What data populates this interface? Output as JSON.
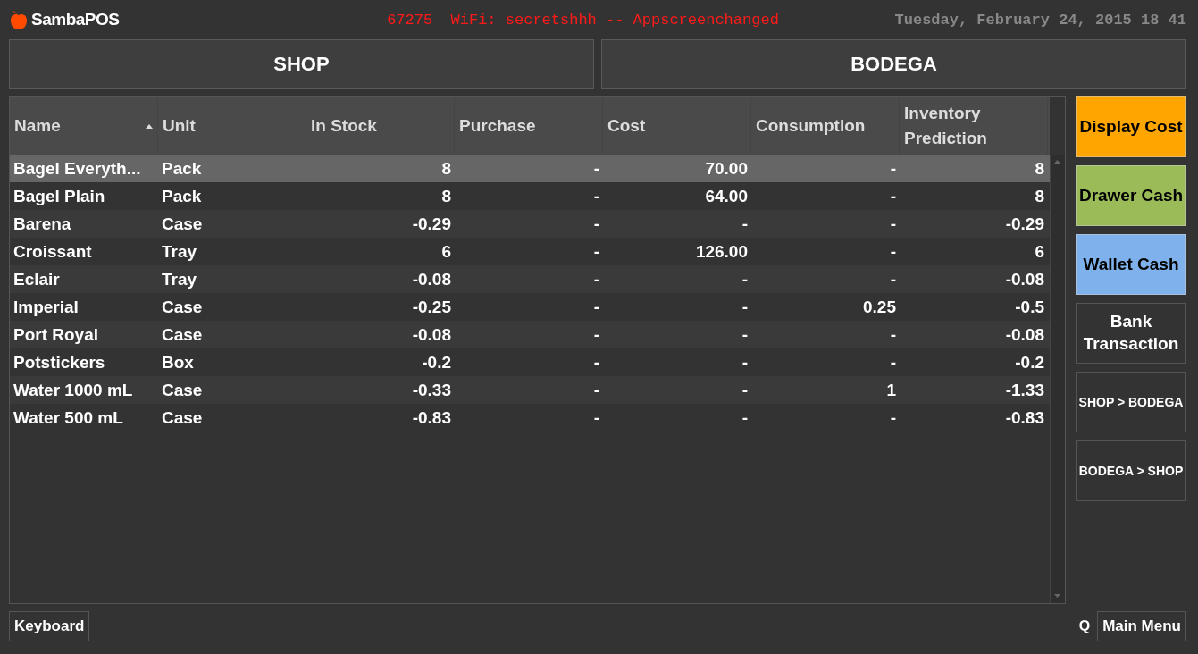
{
  "header": {
    "app_name": "SambaPOS",
    "message": "67275  WiFi: secretshhh -- Appscreenchanged",
    "datetime": "Tuesday, February 24, 2015 18 41"
  },
  "tabs": [
    {
      "label": "SHOP",
      "selected": false
    },
    {
      "label": "BODEGA",
      "selected": false
    }
  ],
  "table": {
    "columns": [
      {
        "label": "Name",
        "kind": "text",
        "sorted": true
      },
      {
        "label": "Unit",
        "kind": "text",
        "sorted": false
      },
      {
        "label": "In Stock",
        "kind": "number",
        "sorted": false
      },
      {
        "label": "Purchase",
        "kind": "number",
        "sorted": false
      },
      {
        "label": "Cost",
        "kind": "number",
        "sorted": false
      },
      {
        "label": "Consumption",
        "kind": "number",
        "sorted": false
      },
      {
        "label": "Inventory Prediction",
        "kind": "number",
        "sorted": false
      }
    ],
    "rows": [
      {
        "selected": true,
        "cells": [
          "Bagel Everyth...",
          "Pack",
          "8",
          "-",
          "70.00",
          "-",
          "8"
        ]
      },
      {
        "selected": false,
        "cells": [
          "Bagel Plain",
          "Pack",
          "8",
          "-",
          "64.00",
          "-",
          "8"
        ]
      },
      {
        "selected": false,
        "cells": [
          "Barena",
          "Case",
          "-0.29",
          "-",
          "-",
          "-",
          "-0.29"
        ]
      },
      {
        "selected": false,
        "cells": [
          "Croissant",
          "Tray",
          "6",
          "-",
          "126.00",
          "-",
          "6"
        ]
      },
      {
        "selected": false,
        "cells": [
          "Eclair",
          "Tray",
          "-0.08",
          "-",
          "-",
          "-",
          "-0.08"
        ]
      },
      {
        "selected": false,
        "cells": [
          "Imperial",
          "Case",
          "-0.25",
          "-",
          "-",
          "0.25",
          "-0.5"
        ]
      },
      {
        "selected": false,
        "cells": [
          "Port Royal",
          "Case",
          "-0.08",
          "-",
          "-",
          "-",
          "-0.08"
        ]
      },
      {
        "selected": false,
        "cells": [
          "Potstickers",
          "Box",
          "-0.2",
          "-",
          "-",
          "-",
          "-0.2"
        ]
      },
      {
        "selected": false,
        "cells": [
          "Water 1000 mL",
          "Case",
          "-0.33",
          "-",
          "-",
          "1",
          "-1.33"
        ]
      },
      {
        "selected": false,
        "cells": [
          "Water 500 mL",
          "Case",
          "-0.83",
          "-",
          "-",
          "-",
          "-0.83"
        ]
      }
    ]
  },
  "actions": [
    {
      "label": "Display Cost",
      "kind": "large",
      "color": "#ffa500"
    },
    {
      "label": "Drawer Cash",
      "kind": "large",
      "color": "#9bbb59"
    },
    {
      "label": "Wallet Cash",
      "kind": "large",
      "color": "#7fb2ec"
    },
    {
      "label": "Bank Transaction",
      "kind": "large"
    },
    {
      "label": "SHOP > BODEGA",
      "kind": "small"
    },
    {
      "label": "BODEGA > SHOP",
      "kind": "small"
    }
  ],
  "footer": {
    "keyboard": "Keyboard",
    "q": "Q",
    "main_menu": "Main Menu"
  }
}
